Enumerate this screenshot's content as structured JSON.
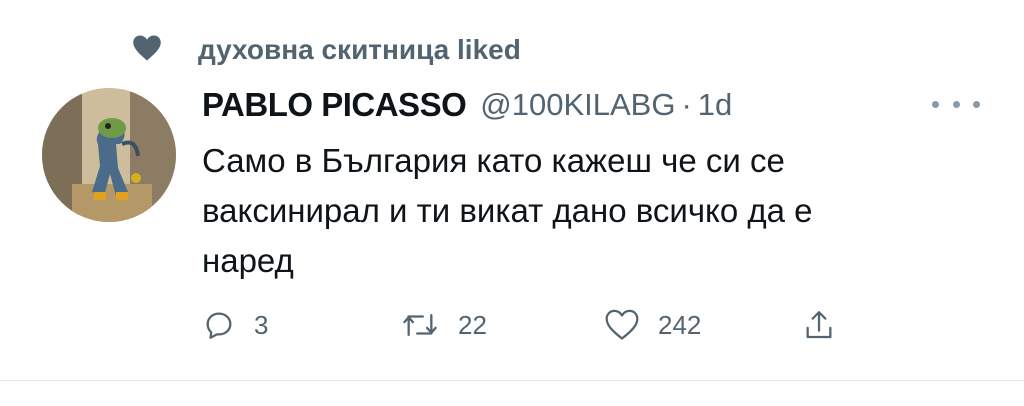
{
  "social_context": {
    "text": "духовна скитница liked",
    "icon": "heart-filled-icon"
  },
  "author": {
    "name": "PABLO PICASSO",
    "handle": "@100KILABG",
    "separator": "·",
    "time": "1d"
  },
  "tweet": {
    "lines": [
      "Само в България като кажеш че си се",
      "ваксинирал и ти викат дано всичко да е",
      "наред"
    ]
  },
  "actions": {
    "reply": {
      "count": "3",
      "icon": "reply-icon"
    },
    "retweet": {
      "count": "22",
      "icon": "retweet-icon"
    },
    "like": {
      "count": "242",
      "icon": "heart-outline-icon"
    },
    "share": {
      "icon": "share-icon"
    }
  },
  "more_icon": "more-dots-icon",
  "colors": {
    "text": "#0f1419",
    "secondary": "#536471",
    "divider": "#e7e9ea"
  }
}
